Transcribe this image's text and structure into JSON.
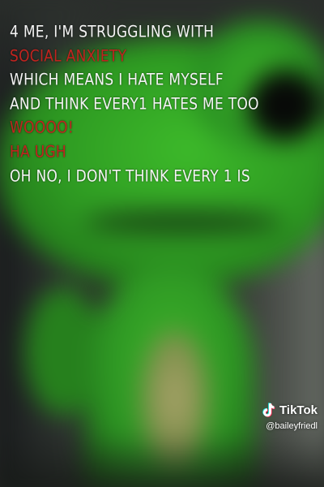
{
  "caption": {
    "lines": [
      {
        "text": "4 ME, I'M STRUGGLING WITH",
        "color": "#f4f4f4"
      },
      {
        "text": "SOCIAL ANXIETY",
        "color": "#c0241f"
      },
      {
        "text": "WHICH MEANS I HATE MYSELF",
        "color": "#f4f4f4"
      },
      {
        "text": "AND THINK EVERY1 HATES ME TOO",
        "color": "#f4f4f4"
      },
      {
        "text": "WOOOO!",
        "color": "#c0241f"
      },
      {
        "text": "HA UGH",
        "color": "#c0241f"
      },
      {
        "text": "OH NO, I DON'T THINK EVERY 1 IS",
        "color": "#f4f4f4"
      }
    ]
  },
  "watermark": {
    "brand": "TikTok",
    "handle": "@baileyfriedl",
    "icon": "tiktok-logo-icon"
  },
  "colors": {
    "frog_green": "#2e9a22",
    "caption_red": "#c0241f",
    "caption_white": "#f4f4f4"
  }
}
